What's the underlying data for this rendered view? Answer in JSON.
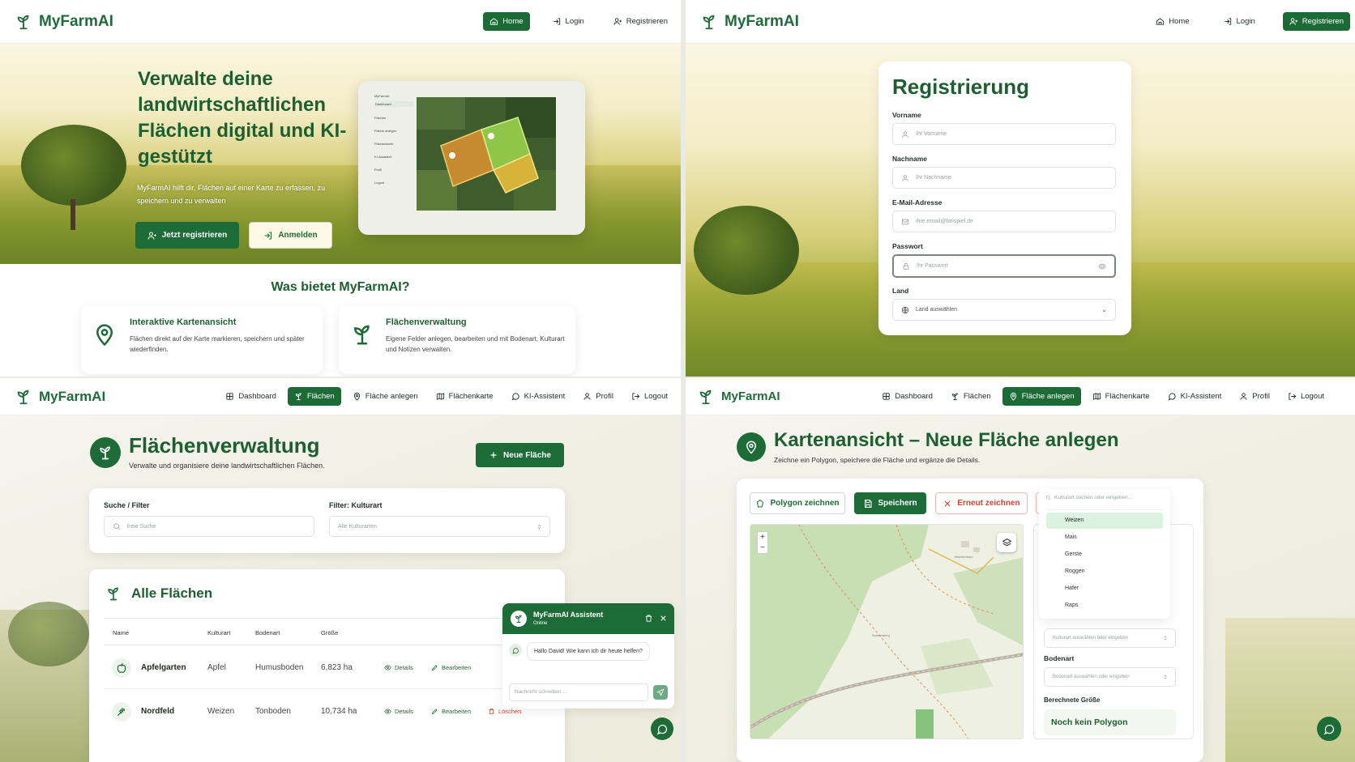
{
  "brand": "MyFarmAI",
  "q1": {
    "nav": {
      "home": "Home",
      "login": "Login",
      "register": "Registrieren"
    },
    "hero_title": "Verwalte deine landwirtschaftlichen Flächen digital und KI-gestützt",
    "hero_sub": "MyFarmAI hilft dir, Flächen auf einer Karte zu erfassen, zu speichern und zu verwalten",
    "cta_register": "Jetzt registrieren",
    "cta_login": "Anmelden",
    "section_title": "Was bietet MyFarmAI?",
    "features": [
      {
        "title": "Interaktive Kartenansicht",
        "text": "Flächen direkt auf der Karte markieren, speichern und später wiederfinden."
      },
      {
        "title": "Flächenverwaltung",
        "text": "Eigene Felder anlegen, bearbeiten und mit Bodenart, Kulturart und Notizen verwalten."
      }
    ],
    "tablet_menu": [
      "MyFarmAI",
      "Dashboard",
      "Flächen",
      "Fläche anlegen",
      "Flächenkarte",
      "KI-Assistent",
      "Profil",
      "Logout"
    ]
  },
  "q2": {
    "nav": {
      "home": "Home",
      "login": "Login",
      "register": "Registrieren"
    },
    "title": "Registrierung",
    "fields": [
      {
        "label": "Vorname",
        "placeholder": "Ihr Vorname"
      },
      {
        "label": "Nachname",
        "placeholder": "Ihr Nachname"
      },
      {
        "label": "E-Mail-Adresse",
        "placeholder": "ihre.email@beispiel.de"
      },
      {
        "label": "Passwort",
        "placeholder": "Ihr Passwort"
      },
      {
        "label": "Land",
        "placeholder": "Land auswählen"
      }
    ]
  },
  "app_nav": {
    "dashboard": "Dashboard",
    "flaechen": "Flächen",
    "anlegen": "Fläche anlegen",
    "karte": "Flächenkarte",
    "ki": "KI-Assistent",
    "profil": "Profil",
    "logout": "Logout"
  },
  "q3": {
    "title": "Flächenverwaltung",
    "subtitle": "Verwalte und organisiere deine landwirtschaftlichen Flächen.",
    "new_button": "Neue Fläche",
    "search_label": "Suche / Filter",
    "search_placeholder": "freie Suche",
    "filter_label": "Filter: Kulturart",
    "filter_value": "Alle Kulturarten",
    "list_title": "Alle Flächen",
    "columns": [
      "Name",
      "Kulturart",
      "Bodenart",
      "Größe"
    ],
    "rows": [
      {
        "name": "Apfelgarten",
        "kultur": "Apfel",
        "boden": "Humusboden",
        "groesse": "6,823 ha",
        "details": "Details",
        "edit": "Bearbeiten",
        "delete": "Löschen"
      },
      {
        "name": "Nordfeld",
        "kultur": "Weizen",
        "boden": "Tonboden",
        "groesse": "10,734 ha",
        "details": "Details",
        "edit": "Bearbeiten",
        "delete": "Löschen"
      }
    ],
    "chat": {
      "title": "MyFarmAI Assistent",
      "status": "Online",
      "message": "Hallo David! Wie kann ich dir heute helfen?",
      "placeholder": "Nachricht schreiben ..."
    }
  },
  "q4": {
    "title": "Kartenansicht – Neue Fläche anlegen",
    "subtitle": "Zeichne ein Polygon, speichere die Fläche und ergänze die Details.",
    "btn_polygon": "Polygon zeichnen",
    "btn_save": "Speichern",
    "btn_redraw": "Erneut zeichnen",
    "kultur_search": "Kulturart suchen oder eingeben...",
    "kultur_options": [
      "Weizen",
      "Mais",
      "Gerste",
      "Roggen",
      "Hafer",
      "Raps"
    ],
    "kultur_select": "Kulturart auswählen oder eingeben",
    "bodenart_label": "Bodenart",
    "bodenart_select": "Bodenart auswählen oder eingeben",
    "size_label": "Berechnete Größe",
    "size_value": "Noch kein Polygon",
    "map_labels": {
      "place1": "Reichenborn",
      "place2": "Sonnenberg"
    },
    "zoom_in": "+",
    "zoom_out": "−"
  },
  "colors": {
    "primary": "#1d6b36",
    "accent_red": "#d9432f"
  }
}
